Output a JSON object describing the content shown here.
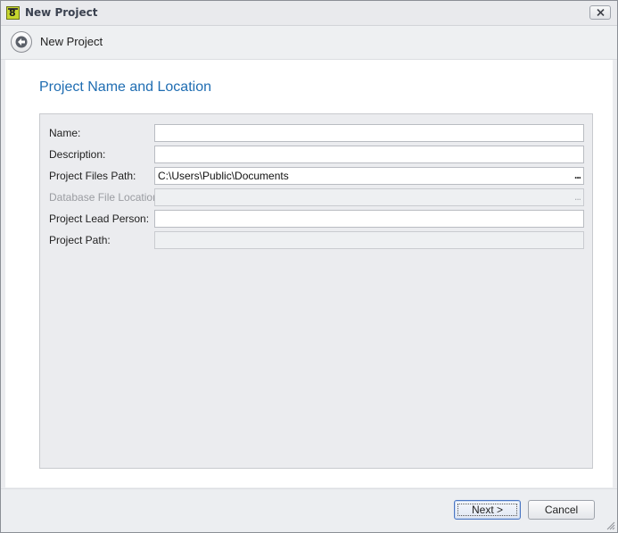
{
  "window": {
    "title": "New Project",
    "app_icon_glyph": "8"
  },
  "header": {
    "title": "New Project"
  },
  "section": {
    "title": "Project Name and Location"
  },
  "form": {
    "fields": [
      {
        "label": "Name:",
        "value": "",
        "enabled": true
      },
      {
        "label": "Description:",
        "value": "",
        "enabled": true
      },
      {
        "label": "Project Files Path:",
        "value": "C:\\Users\\Public\\Documents",
        "enabled": true,
        "browse": "..."
      },
      {
        "label": "Database File Location:",
        "value": "",
        "enabled": false,
        "browse": "..."
      },
      {
        "label": "Project Lead Person:",
        "value": "",
        "enabled": true
      },
      {
        "label": "Project Path:",
        "value": "",
        "enabled": false
      }
    ]
  },
  "footer": {
    "next_label": "Next >",
    "cancel_label": "Cancel"
  },
  "colors": {
    "accent": "#1f6db2",
    "window_bg": "#ebecef",
    "disabled_text": "#9a9ca1"
  },
  "icons": {
    "app": "app-logo-icon",
    "close": "close-icon",
    "back": "back-arrow-icon",
    "grip": "resize-grip-icon"
  }
}
